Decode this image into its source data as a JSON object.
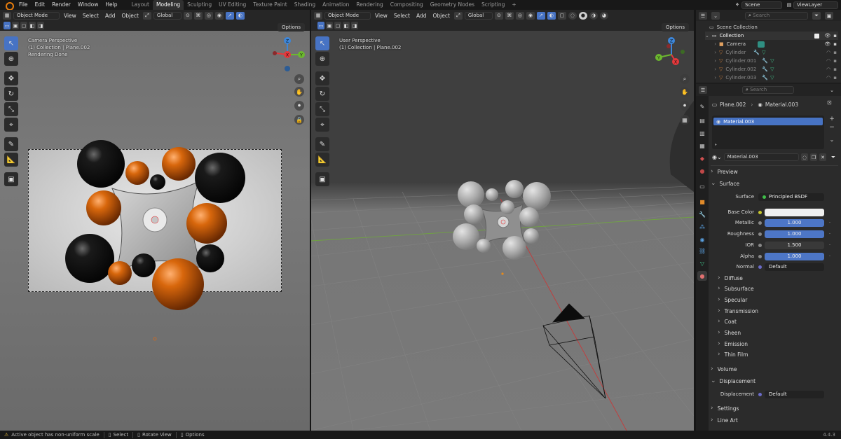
{
  "menu": [
    "File",
    "Edit",
    "Render",
    "Window",
    "Help"
  ],
  "workspaces": [
    {
      "label": "Layout",
      "active": false
    },
    {
      "label": "Modeling",
      "active": true
    },
    {
      "label": "Sculpting",
      "active": false
    },
    {
      "label": "UV Editing",
      "active": false
    },
    {
      "label": "Texture Paint",
      "active": false
    },
    {
      "label": "Shading",
      "active": false
    },
    {
      "label": "Animation",
      "active": false
    },
    {
      "label": "Rendering",
      "active": false
    },
    {
      "label": "Compositing",
      "active": false
    },
    {
      "label": "Geometry Nodes",
      "active": false
    },
    {
      "label": "Scripting",
      "active": false
    }
  ],
  "add_workspace": "+",
  "scene": {
    "name": "Scene",
    "viewlayer": "ViewLayer"
  },
  "left_vp": {
    "mode": "Object Mode",
    "menus": [
      "View",
      "Select",
      "Add",
      "Object"
    ],
    "orientation": "Global",
    "options": "Options",
    "info": [
      "Camera Perspective",
      "(1) Collection | Plane.002",
      "Rendering Done"
    ]
  },
  "right_vp": {
    "mode": "Object Mode",
    "menus": [
      "View",
      "Select",
      "Add",
      "Object"
    ],
    "orientation": "Global",
    "options": "Options",
    "info": [
      "User Perspective",
      "(1) Collection | Plane.002"
    ]
  },
  "gizmo": {
    "z": "Z",
    "x": "X",
    "y": "Y"
  },
  "outliner": {
    "search_placeholder": "Search",
    "root": "Scene Collection",
    "collection": "Collection",
    "items": [
      "Camera",
      "Cylinder",
      "Cylinder.001",
      "Cylinder.002",
      "Cylinder.003"
    ]
  },
  "properties": {
    "search_placeholder": "Search",
    "breadcrumb": [
      "Plane.002",
      "Material.003"
    ],
    "slot": "Material.003",
    "material_name": "Material.003",
    "panels": {
      "preview": "Preview",
      "surface": "Surface",
      "surface_label": "Surface",
      "surface_value": "Principled BSDF",
      "base_color_label": "Base Color",
      "metallic_label": "Metallic",
      "metallic": "1.000",
      "roughness_label": "Roughness",
      "roughness": "1.000",
      "ior_label": "IOR",
      "ior": "1.500",
      "alpha_label": "Alpha",
      "alpha": "1.000",
      "normal_label": "Normal",
      "normal": "Default",
      "subs": [
        "Diffuse",
        "Subsurface",
        "Specular",
        "Transmission",
        "Coat",
        "Sheen",
        "Emission",
        "Thin Film"
      ],
      "volume": "Volume",
      "displacement": "Displacement",
      "displacement_label": "Displacement",
      "displacement_value": "Default",
      "settings": "Settings",
      "line_art": "Line Art"
    }
  },
  "status": {
    "message": "Active object has non-uniform scale",
    "select": "Select",
    "rotate": "Rotate View",
    "options": "Options",
    "version": "4.4.3"
  },
  "colors": {
    "accent": "#4773c4",
    "orange": "#e0760f",
    "gizmo_x": "#e5383b",
    "gizmo_y": "#6cb82f",
    "gizmo_z": "#3d86d9"
  }
}
